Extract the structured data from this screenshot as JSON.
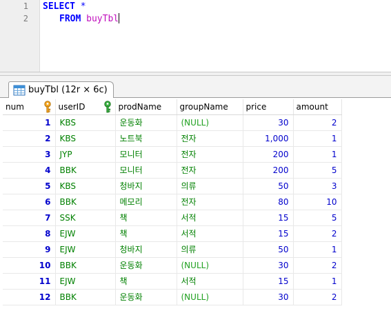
{
  "editor": {
    "lines": [
      {
        "number": "1",
        "keyword": "SELECT",
        "rest": "*",
        "identifier": ""
      },
      {
        "number": "2",
        "keyword": "FROM",
        "rest": "",
        "identifier": "buyTbl"
      }
    ],
    "colors": {
      "keyword": "#0000ff",
      "identifier": "#c10fbd"
    }
  },
  "result_tab": {
    "label": "buyTbl (12r × 6c)",
    "icon": "table-grid-icon"
  },
  "grid": {
    "columns": [
      {
        "label": "num",
        "icon": "primary-key-icon"
      },
      {
        "label": "userID",
        "icon": "foreign-key-icon"
      },
      {
        "label": "prodName",
        "icon": ""
      },
      {
        "label": "groupName",
        "icon": ""
      },
      {
        "label": "price",
        "icon": ""
      },
      {
        "label": "amount",
        "icon": ""
      }
    ],
    "rows": [
      {
        "num": "1",
        "userID": "KBS",
        "prodName": "운동화",
        "groupName": "(NULL)",
        "price": "30",
        "amount": "2"
      },
      {
        "num": "2",
        "userID": "KBS",
        "prodName": "노트북",
        "groupName": "전자",
        "price": "1,000",
        "amount": "1"
      },
      {
        "num": "3",
        "userID": "JYP",
        "prodName": "모니터",
        "groupName": "전자",
        "price": "200",
        "amount": "1"
      },
      {
        "num": "4",
        "userID": "BBK",
        "prodName": "모니터",
        "groupName": "전자",
        "price": "200",
        "amount": "5"
      },
      {
        "num": "5",
        "userID": "KBS",
        "prodName": "청바지",
        "groupName": "의류",
        "price": "50",
        "amount": "3"
      },
      {
        "num": "6",
        "userID": "BBK",
        "prodName": "메모리",
        "groupName": "전자",
        "price": "80",
        "amount": "10"
      },
      {
        "num": "7",
        "userID": "SSK",
        "prodName": "책",
        "groupName": "서적",
        "price": "15",
        "amount": "5"
      },
      {
        "num": "8",
        "userID": "EJW",
        "prodName": "책",
        "groupName": "서적",
        "price": "15",
        "amount": "2"
      },
      {
        "num": "9",
        "userID": "EJW",
        "prodName": "청바지",
        "groupName": "의류",
        "price": "50",
        "amount": "1"
      },
      {
        "num": "10",
        "userID": "BBK",
        "prodName": "운동화",
        "groupName": "(NULL)",
        "price": "30",
        "amount": "2"
      },
      {
        "num": "11",
        "userID": "EJW",
        "prodName": "책",
        "groupName": "서적",
        "price": "15",
        "amount": "1"
      },
      {
        "num": "12",
        "userID": "BBK",
        "prodName": "운동화",
        "groupName": "(NULL)",
        "price": "30",
        "amount": "2"
      }
    ],
    "colors": {
      "numeric": "#0000cc",
      "text": "#008000",
      "null": "#1fa01f",
      "primary_key": "#f0a020",
      "foreign_key": "#22a022"
    }
  }
}
